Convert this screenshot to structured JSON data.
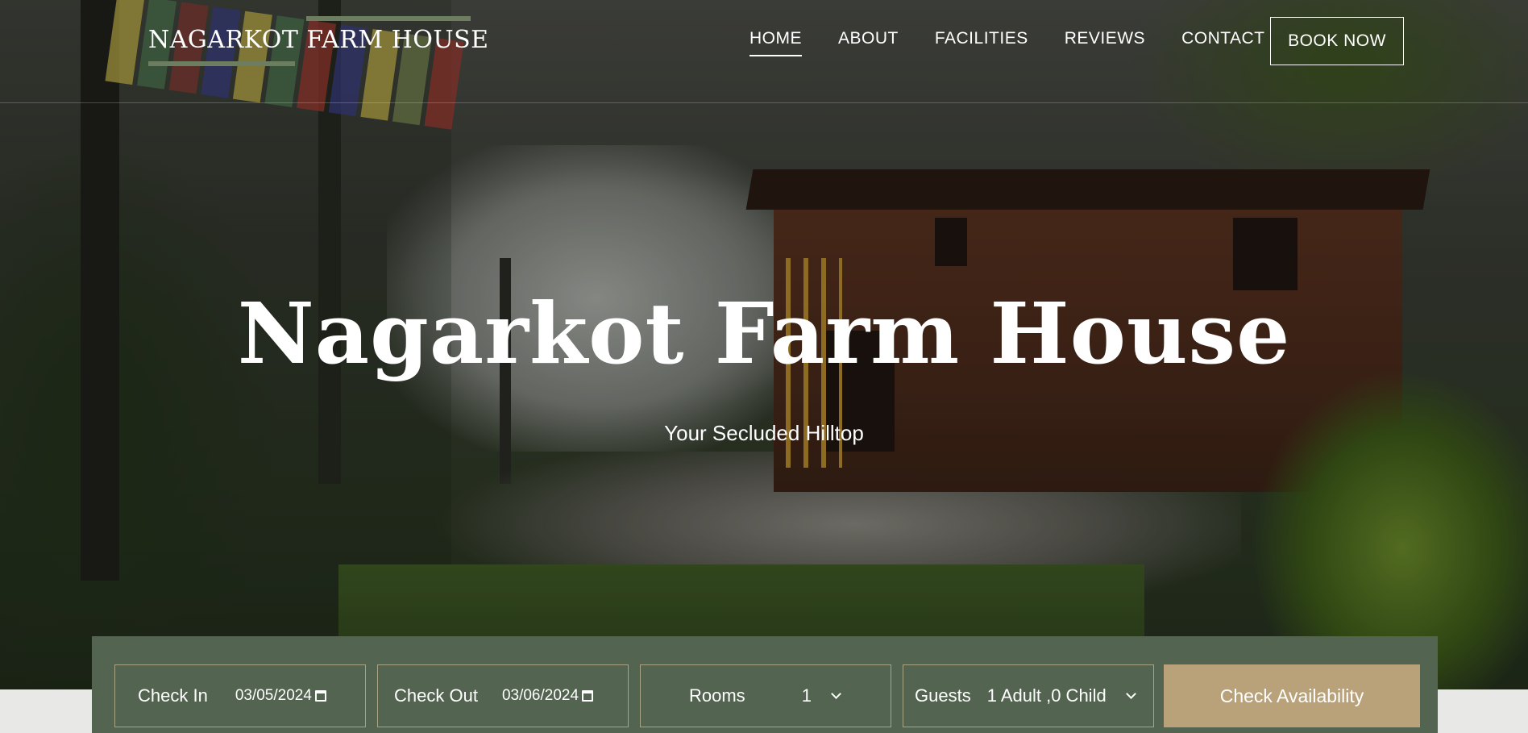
{
  "brand": {
    "logo_text": "NAGARKOT FARM HOUSE",
    "accent": "#6c7d60"
  },
  "nav": {
    "items": [
      {
        "label": "HOME",
        "active": true
      },
      {
        "label": "ABOUT",
        "active": false
      },
      {
        "label": "FACILITIES",
        "active": false
      },
      {
        "label": "REVIEWS",
        "active": false
      },
      {
        "label": "CONTACT",
        "active": false
      }
    ],
    "book_label": "BOOK NOW"
  },
  "hero": {
    "title": "Nagarkot Farm House",
    "subtitle": "Your Secluded Hilltop"
  },
  "booking": {
    "background": "#536550",
    "check_in": {
      "label": "Check In",
      "value": "03/05/2024",
      "icon": "calendar-icon"
    },
    "check_out": {
      "label": "Check Out",
      "value": "03/06/2024",
      "icon": "calendar-icon"
    },
    "rooms": {
      "label": "Rooms",
      "value": "1",
      "icon": "chevron-down-icon"
    },
    "guests": {
      "label": "Guests",
      "value": "1 Adult ,0 Child",
      "icon": "chevron-down-icon"
    },
    "submit_label": "Check Availability",
    "submit_color": "#b9a27a"
  }
}
